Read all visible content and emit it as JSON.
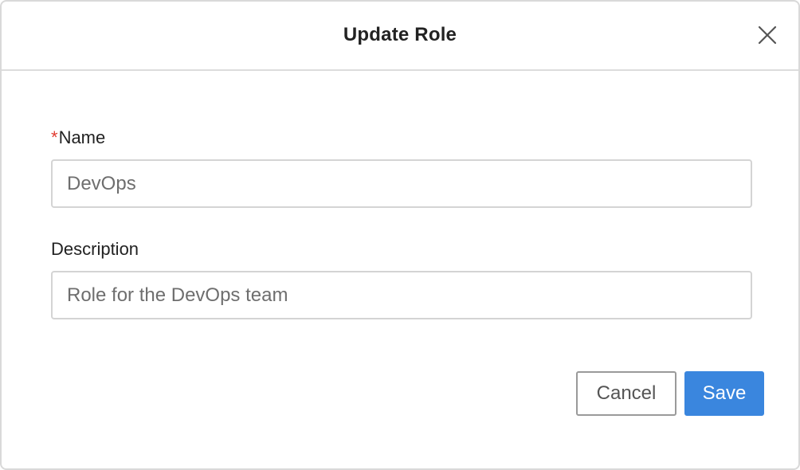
{
  "dialog": {
    "title": "Update Role",
    "close_icon": "close-icon"
  },
  "form": {
    "name": {
      "required_marker": "*",
      "label": "Name",
      "value": "DevOps"
    },
    "description": {
      "label": "Description",
      "value": "Role for the DevOps team"
    }
  },
  "actions": {
    "cancel_label": "Cancel",
    "save_label": "Save"
  },
  "colors": {
    "primary": "#3a86de",
    "required": "#e03c31",
    "border": "#d4d4d4"
  }
}
